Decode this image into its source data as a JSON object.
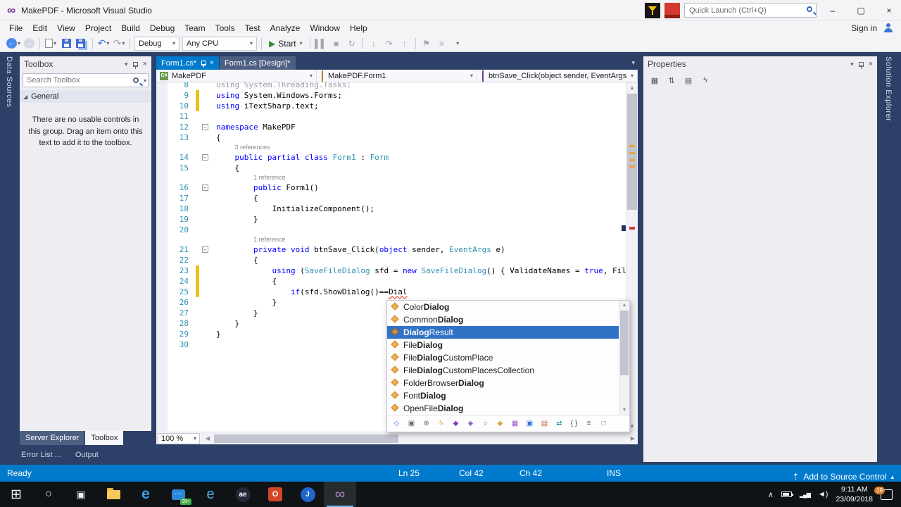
{
  "window": {
    "title": "MakePDF - Microsoft Visual Studio",
    "quick_launch": "Quick Launch (Ctrl+Q)",
    "minimize": "–",
    "maximize": "▢",
    "close": "×"
  },
  "menu": {
    "items": [
      "File",
      "Edit",
      "View",
      "Project",
      "Build",
      "Debug",
      "Team",
      "Tools",
      "Test",
      "Analyze",
      "Window",
      "Help"
    ],
    "sign_in": "Sign in"
  },
  "toolbar": {
    "debug_target": "Debug",
    "platform": "Any CPU",
    "start": "Start"
  },
  "strips": {
    "left": "Data Sources",
    "right": "Solution Explorer"
  },
  "toolbox": {
    "title": "Toolbox",
    "search": "Search Toolbox",
    "group": "General",
    "empty": "There are no usable controls in this group. Drag an item onto this text to add it to the toolbox.",
    "tabs": [
      "Server Explorer",
      "Toolbox"
    ],
    "autohide": [
      "Error List ...",
      "Output"
    ]
  },
  "properties": {
    "title": "Properties"
  },
  "editor": {
    "tabs": [
      {
        "label": "Form1.cs*",
        "active": true
      },
      {
        "label": "Form1.cs [Design]*",
        "active": false
      }
    ],
    "nav": [
      {
        "label": "MakePDF",
        "icon": "csharp-project"
      },
      {
        "label": "MakePDF.Form1",
        "icon": "class"
      },
      {
        "label": "btnSave_Click(object sender, EventArgs",
        "icon": "method"
      }
    ],
    "zoom": "100 %",
    "lines": [
      {
        "n": 8,
        "seg": [
          [
            "g",
            "using System.Threading.Tasks;"
          ]
        ]
      },
      {
        "n": 9,
        "bar": 1,
        "seg": [
          [
            "k",
            "using"
          ],
          [
            "p",
            " System.Windows.Forms;"
          ]
        ]
      },
      {
        "n": 10,
        "bar": 1,
        "seg": [
          [
            "k",
            "using"
          ],
          [
            "p",
            " iTextSharp.text;"
          ]
        ]
      },
      {
        "n": 11,
        "seg": []
      },
      {
        "n": 12,
        "fold": 1,
        "seg": [
          [
            "k",
            "namespace"
          ],
          [
            "p",
            " MakePDF"
          ]
        ]
      },
      {
        "n": 13,
        "seg": [
          [
            "p",
            "{"
          ]
        ]
      },
      {
        "n": 14,
        "fold": 1,
        "cl": "3 references",
        "cli": 4,
        "seg": [
          [
            "p",
            "    "
          ],
          [
            "k",
            "public"
          ],
          [
            "p",
            " "
          ],
          [
            "k",
            "partial"
          ],
          [
            "p",
            " "
          ],
          [
            "k",
            "class"
          ],
          [
            "p",
            " "
          ],
          [
            "t",
            "Form1"
          ],
          [
            "p",
            " : "
          ],
          [
            "t",
            "Form"
          ]
        ]
      },
      {
        "n": 15,
        "seg": [
          [
            "p",
            "    {"
          ]
        ]
      },
      {
        "n": 16,
        "fold": 1,
        "cl": "1 reference",
        "cli": 8,
        "seg": [
          [
            "p",
            "        "
          ],
          [
            "k",
            "public"
          ],
          [
            "p",
            " Form1()"
          ]
        ]
      },
      {
        "n": 17,
        "seg": [
          [
            "p",
            "        {"
          ]
        ]
      },
      {
        "n": 18,
        "seg": [
          [
            "p",
            "            InitializeComponent();"
          ]
        ]
      },
      {
        "n": 19,
        "seg": [
          [
            "p",
            "        }"
          ]
        ]
      },
      {
        "n": 20,
        "seg": []
      },
      {
        "n": 21,
        "fold": 1,
        "cl": "1 reference",
        "cli": 8,
        "seg": [
          [
            "p",
            "        "
          ],
          [
            "k",
            "private"
          ],
          [
            "p",
            " "
          ],
          [
            "k",
            "void"
          ],
          [
            "p",
            " btnSave_Click("
          ],
          [
            "k",
            "object"
          ],
          [
            "p",
            " sender, "
          ],
          [
            "t",
            "EventArgs"
          ],
          [
            "p",
            " e)"
          ]
        ]
      },
      {
        "n": 22,
        "seg": [
          [
            "p",
            "        {"
          ]
        ]
      },
      {
        "n": 23,
        "bar": 1,
        "seg": [
          [
            "p",
            "            "
          ],
          [
            "k",
            "using"
          ],
          [
            "p",
            " ("
          ],
          [
            "t",
            "SaveFileDialog"
          ],
          [
            "p",
            " sfd = "
          ],
          [
            "k",
            "new"
          ],
          [
            "p",
            " "
          ],
          [
            "t",
            "SaveFileDialog"
          ],
          [
            "p",
            "() { ValidateNames = "
          ],
          [
            "k",
            "true"
          ],
          [
            "p",
            ", Fil"
          ]
        ]
      },
      {
        "n": 24,
        "bar": 1,
        "seg": [
          [
            "p",
            "            {"
          ]
        ]
      },
      {
        "n": 25,
        "bar": 1,
        "seg": [
          [
            "p",
            "                "
          ],
          [
            "k",
            "if"
          ],
          [
            "p",
            "(sfd.ShowDialog()=="
          ],
          [
            "e",
            "Dial"
          ]
        ]
      },
      {
        "n": 26,
        "seg": [
          [
            "p",
            "            }"
          ]
        ]
      },
      {
        "n": 27,
        "seg": [
          [
            "p",
            "        }"
          ]
        ]
      },
      {
        "n": 28,
        "seg": [
          [
            "p",
            "    }"
          ]
        ]
      },
      {
        "n": 29,
        "seg": [
          [
            "p",
            "}"
          ]
        ]
      },
      {
        "n": 30,
        "seg": []
      }
    ]
  },
  "intellisense": {
    "items": [
      {
        "pre": "Color",
        "match": "Dialog",
        "post": "",
        "icon": "class",
        "sel": false
      },
      {
        "pre": "Common",
        "match": "Dialog",
        "post": "",
        "icon": "class",
        "sel": false
      },
      {
        "pre": "",
        "match": "Dialog",
        "post": "Result",
        "icon": "enum",
        "sel": true
      },
      {
        "pre": "File",
        "match": "Dialog",
        "post": "",
        "icon": "class",
        "sel": false
      },
      {
        "pre": "File",
        "match": "Dialog",
        "post": "CustomPlace",
        "icon": "class",
        "sel": false
      },
      {
        "pre": "File",
        "match": "Dialog",
        "post": "CustomPlacesCollection",
        "icon": "class",
        "sel": false
      },
      {
        "pre": "FolderBrowser",
        "match": "Dialog",
        "post": "",
        "icon": "class",
        "sel": false
      },
      {
        "pre": "Font",
        "match": "Dialog",
        "post": "",
        "icon": "class",
        "sel": false
      },
      {
        "pre": "OpenFile",
        "match": "Dialog",
        "post": "",
        "icon": "class",
        "sel": false
      }
    ],
    "filters": [
      "variable-filter",
      "constant-filter",
      "property-filter",
      "event-filter",
      "method-filter",
      "extension-method-filter",
      "interface-filter",
      "class-filter",
      "module-filter",
      "struct-filter",
      "enum-filter",
      "delegate-filter",
      "namespace-filter",
      "snippet-filter",
      "expander-filter"
    ]
  },
  "status": {
    "ready": "Ready",
    "ln": "Ln 25",
    "col": "Col 42",
    "ch": "Ch 42",
    "mode": "INS",
    "scc": "Add to Source Control"
  },
  "taskbar": {
    "apps": [
      "start",
      "search",
      "task-view",
      "file-explorer",
      "edge",
      "messaging",
      "ie",
      "ae",
      "office",
      "j-app",
      "visual-studio"
    ],
    "active_app": "visual-studio",
    "chat_badge": "99+",
    "notif_badge": "19",
    "time": "9:11 AM",
    "date": "23/09/2018"
  }
}
